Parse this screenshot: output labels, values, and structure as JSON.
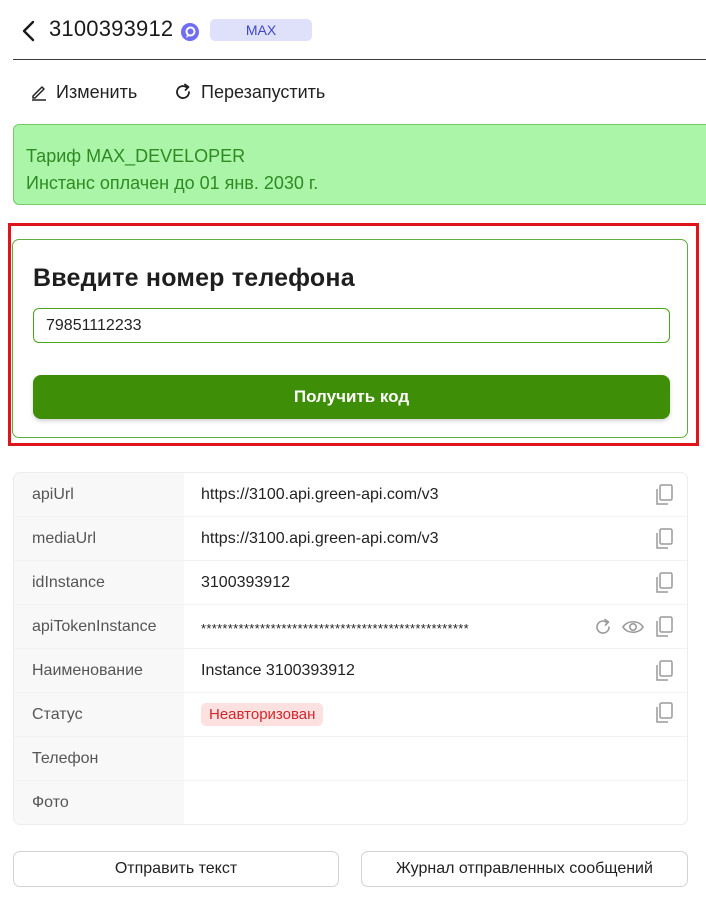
{
  "header": {
    "instance_id": "3100393912",
    "max_tag": "MAX"
  },
  "actions": {
    "edit": "Изменить",
    "restart": "Перезапустить"
  },
  "tariff": {
    "plan": "Тариф MAX_DEVELOPER",
    "paid_until": "Инстанс оплачен до 01 янв. 2030 г."
  },
  "phone_form": {
    "title": "Введите номер телефона",
    "phone_value": "79851112233",
    "submit_label": "Получить код"
  },
  "info": {
    "rows": [
      {
        "key": "apiUrl",
        "value": "https://3100.api.green-api.com/v3"
      },
      {
        "key": "mediaUrl",
        "value": "https://3100.api.green-api.com/v3"
      },
      {
        "key": "idInstance",
        "value": "3100393912"
      },
      {
        "key": "apiTokenInstance",
        "value": "**************************************************"
      },
      {
        "key": "Наименование",
        "value": "Instance 3100393912"
      },
      {
        "key": "Статус",
        "value": "Неавторизован"
      },
      {
        "key": "Телефон",
        "value": ""
      },
      {
        "key": "Фото",
        "value": ""
      }
    ]
  },
  "footer": {
    "send_text": "Отправить текст",
    "journal": "Журнал отправленных сообщений"
  },
  "colors": {
    "accent_green": "#3e8e08",
    "tariff_bg": "#aaf5a7",
    "status_red": "#d3252a",
    "highlight_frame": "#e0141b"
  }
}
